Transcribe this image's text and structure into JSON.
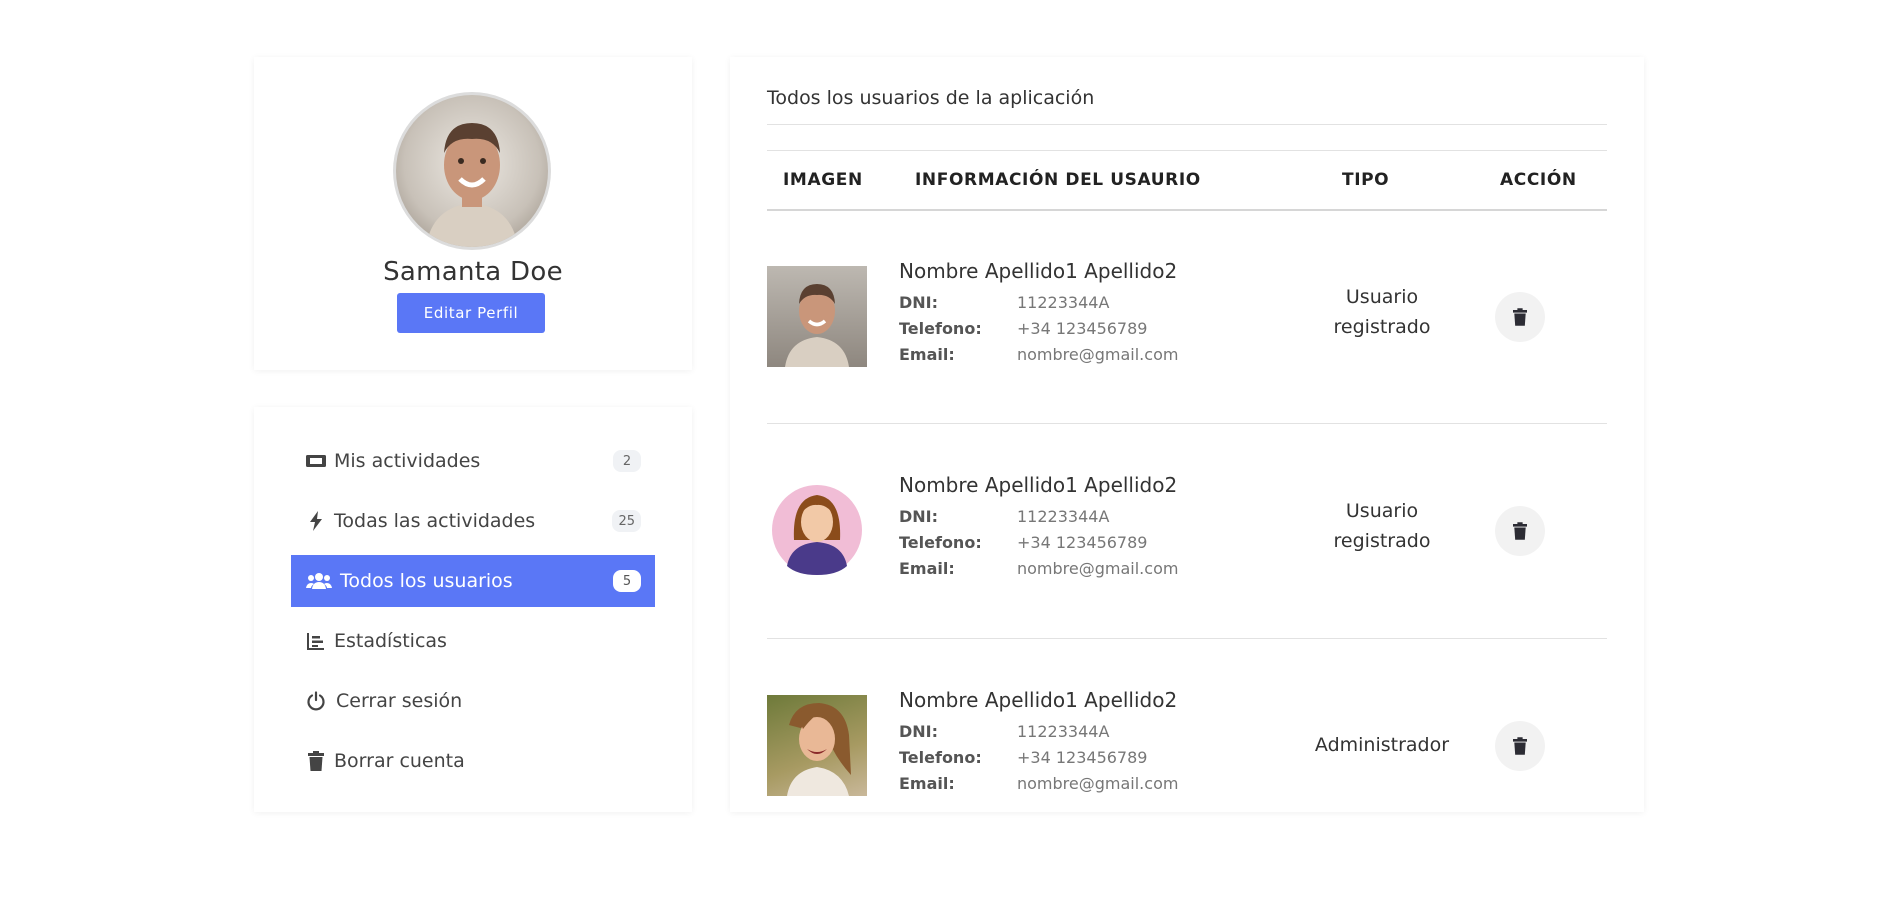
{
  "profile": {
    "name": "Samanta Doe",
    "edit_label": "Editar Perfil"
  },
  "menu": {
    "items": [
      {
        "label": "Mis actividades",
        "icon": "ticket-icon",
        "count": "2"
      },
      {
        "label": "Todas las actividades",
        "icon": "bolt-icon",
        "count": "25"
      },
      {
        "label": "Todos los usuarios",
        "icon": "users-icon",
        "count": "5",
        "active": true
      },
      {
        "label": "Estadísticas",
        "icon": "chart-icon"
      },
      {
        "label": "Cerrar sesión",
        "icon": "power-icon"
      },
      {
        "label": "Borrar cuenta",
        "icon": "trash-icon"
      }
    ]
  },
  "users_panel": {
    "title": "Todos los usuarios de la aplicación",
    "headers": {
      "image": "IMAGEN",
      "info": "INFORMACIÓN DEL USAURIO",
      "type": "TIPO",
      "action": "ACCIÓN"
    },
    "field_labels": {
      "dni": "DNI:",
      "phone": "Telefono:",
      "email": "Email:"
    },
    "rows": [
      {
        "name": "Nombre Apellido1 Apellido2",
        "dni": "11223344A",
        "phone": "+34 123456789",
        "email": "nombre@gmail.com",
        "type_line1": "Usuario",
        "type_line2": "registrado",
        "photo": "man-photo"
      },
      {
        "name": "Nombre Apellido1 Apellido2",
        "dni": "11223344A",
        "phone": "+34 123456789",
        "email": "nombre@gmail.com",
        "type_line1": "Usuario",
        "type_line2": "registrado",
        "photo": "woman-avatar-illustration"
      },
      {
        "name": "Nombre Apellido1 Apellido2",
        "dni": "11223344A",
        "phone": "+34 123456789",
        "email": "nombre@gmail.com",
        "type_line1": "Administrador",
        "type_line2": "",
        "photo": "woman-photo"
      }
    ]
  },
  "colors": {
    "accent": "#5a77f6",
    "text": "#333333",
    "muted": "#777777",
    "divider": "#e2e2e2"
  }
}
